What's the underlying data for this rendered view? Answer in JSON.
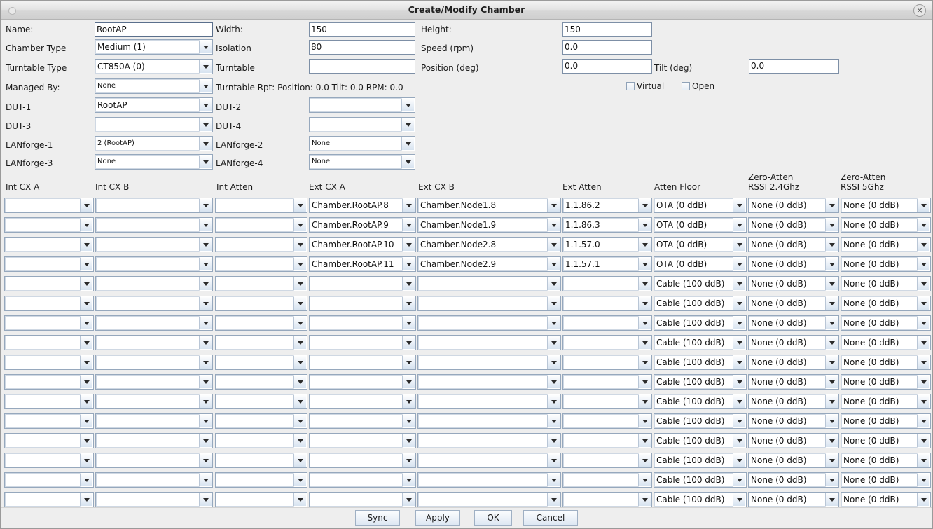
{
  "window": {
    "title": "Create/Modify Chamber",
    "close_label": "×",
    "menu_dot": ""
  },
  "form": {
    "name_label": "Name:",
    "name_value": "RootAP",
    "width_label": "Width:",
    "width_value": "150",
    "height_label": "Height:",
    "height_value": "150",
    "chamber_type_label": "Chamber Type",
    "chamber_type_value": "Medium (1)",
    "isolation_label": "Isolation",
    "isolation_value": "80",
    "speed_label": "Speed (rpm)",
    "speed_value": "0.0",
    "turntable_type_label": "Turntable Type",
    "turntable_type_value": "CT850A (0)",
    "turntable_label": "Turntable",
    "turntable_value": "",
    "position_label": "Position (deg)",
    "position_value": "0.0",
    "tilt_label": "Tilt (deg)",
    "tilt_value": "0.0",
    "managed_by_label": "Managed By:",
    "managed_by_value": "None",
    "turntable_rpt": "Turntable Rpt: Position: 0.0 Tilt: 0.0 RPM: 0.0",
    "virtual_label": "Virtual",
    "virtual_checked": false,
    "open_label": "Open",
    "open_checked": false,
    "dut1_label": "DUT-1",
    "dut1_value": "RootAP",
    "dut2_label": "DUT-2",
    "dut2_value": "",
    "dut3_label": "DUT-3",
    "dut3_value": "",
    "dut4_label": "DUT-4",
    "dut4_value": "",
    "lanforge1_label": "LANforge-1",
    "lanforge1_value": "2  (RootAP)",
    "lanforge2_label": "LANforge-2",
    "lanforge2_value": "None",
    "lanforge3_label": "LANforge-3",
    "lanforge3_value": "None",
    "lanforge4_label": "LANforge-4",
    "lanforge4_value": "None"
  },
  "table": {
    "columns": [
      "Int CX A",
      "Int CX B",
      "Int Atten",
      "Ext CX A",
      "Ext CX B",
      "Ext Atten",
      "Atten Floor",
      "Zero-Atten\nRSSI 2.4Ghz",
      "Zero-Atten\nRSSI 5Ghz"
    ],
    "rows": [
      [
        "",
        "",
        "",
        "Chamber.RootAP.8",
        "Chamber.Node1.8",
        "1.1.86.2",
        "OTA (0 ddB)",
        "None (0 ddB)",
        "None (0 ddB)"
      ],
      [
        "",
        "",
        "",
        "Chamber.RootAP.9",
        "Chamber.Node1.9",
        "1.1.86.3",
        "OTA (0 ddB)",
        "None (0 ddB)",
        "None (0 ddB)"
      ],
      [
        "",
        "",
        "",
        "Chamber.RootAP.10",
        "Chamber.Node2.8",
        "1.1.57.0",
        "OTA (0 ddB)",
        "None (0 ddB)",
        "None (0 ddB)"
      ],
      [
        "",
        "",
        "",
        "Chamber.RootAP.11",
        "Chamber.Node2.9",
        "1.1.57.1",
        "OTA (0 ddB)",
        "None (0 ddB)",
        "None (0 ddB)"
      ],
      [
        "",
        "",
        "",
        "",
        "",
        "",
        "Cable (100 ddB)",
        "None (0 ddB)",
        "None (0 ddB)"
      ],
      [
        "",
        "",
        "",
        "",
        "",
        "",
        "Cable (100 ddB)",
        "None (0 ddB)",
        "None (0 ddB)"
      ],
      [
        "",
        "",
        "",
        "",
        "",
        "",
        "Cable (100 ddB)",
        "None (0 ddB)",
        "None (0 ddB)"
      ],
      [
        "",
        "",
        "",
        "",
        "",
        "",
        "Cable (100 ddB)",
        "None (0 ddB)",
        "None (0 ddB)"
      ],
      [
        "",
        "",
        "",
        "",
        "",
        "",
        "Cable (100 ddB)",
        "None (0 ddB)",
        "None (0 ddB)"
      ],
      [
        "",
        "",
        "",
        "",
        "",
        "",
        "Cable (100 ddB)",
        "None (0 ddB)",
        "None (0 ddB)"
      ],
      [
        "",
        "",
        "",
        "",
        "",
        "",
        "Cable (100 ddB)",
        "None (0 ddB)",
        "None (0 ddB)"
      ],
      [
        "",
        "",
        "",
        "",
        "",
        "",
        "Cable (100 ddB)",
        "None (0 ddB)",
        "None (0 ddB)"
      ],
      [
        "",
        "",
        "",
        "",
        "",
        "",
        "Cable (100 ddB)",
        "None (0 ddB)",
        "None (0 ddB)"
      ],
      [
        "",
        "",
        "",
        "",
        "",
        "",
        "Cable (100 ddB)",
        "None (0 ddB)",
        "None (0 ddB)"
      ],
      [
        "",
        "",
        "",
        "",
        "",
        "",
        "Cable (100 ddB)",
        "None (0 ddB)",
        "None (0 ddB)"
      ],
      [
        "",
        "",
        "",
        "",
        "",
        "",
        "Cable (100 ddB)",
        "None (0 ddB)",
        "None (0 ddB)"
      ]
    ]
  },
  "buttons": {
    "sync": "Sync",
    "apply": "Apply",
    "ok": "OK",
    "cancel": "Cancel"
  },
  "colors": {
    "window_bg": "#eeeeee",
    "field_bg": "#ffffff",
    "field_border": "#7d8fa6",
    "combo_border": "#96a8bd",
    "titlebar": "#e0e0e0"
  }
}
